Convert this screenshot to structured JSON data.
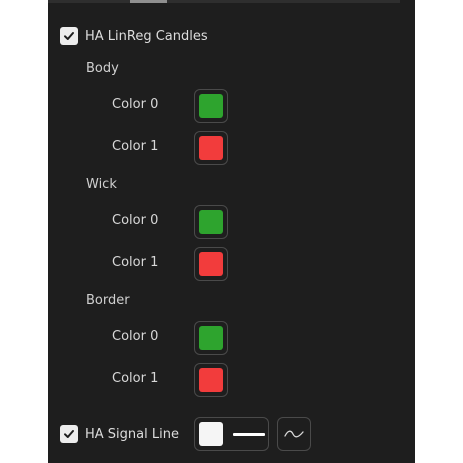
{
  "colors": {
    "green": "#2ea42e",
    "red": "#f23c3c",
    "white": "#f5f5f5"
  },
  "ha_linreg": {
    "label": "HA LinReg Candles",
    "checked": true
  },
  "groups": {
    "body": {
      "label": "Body",
      "color0": {
        "label": "Color 0",
        "value": "#2ea42e"
      },
      "color1": {
        "label": "Color 1",
        "value": "#f23c3c"
      }
    },
    "wick": {
      "label": "Wick",
      "color0": {
        "label": "Color 0",
        "value": "#2ea42e"
      },
      "color1": {
        "label": "Color 1",
        "value": "#f23c3c"
      }
    },
    "border": {
      "label": "Border",
      "color0": {
        "label": "Color 0",
        "value": "#2ea42e"
      },
      "color1": {
        "label": "Color 1",
        "value": "#f23c3c"
      }
    }
  },
  "ha_signal": {
    "label": "HA Signal Line",
    "checked": true,
    "line_color": "#f5f5f5",
    "style_icon": "line-style-icon"
  }
}
